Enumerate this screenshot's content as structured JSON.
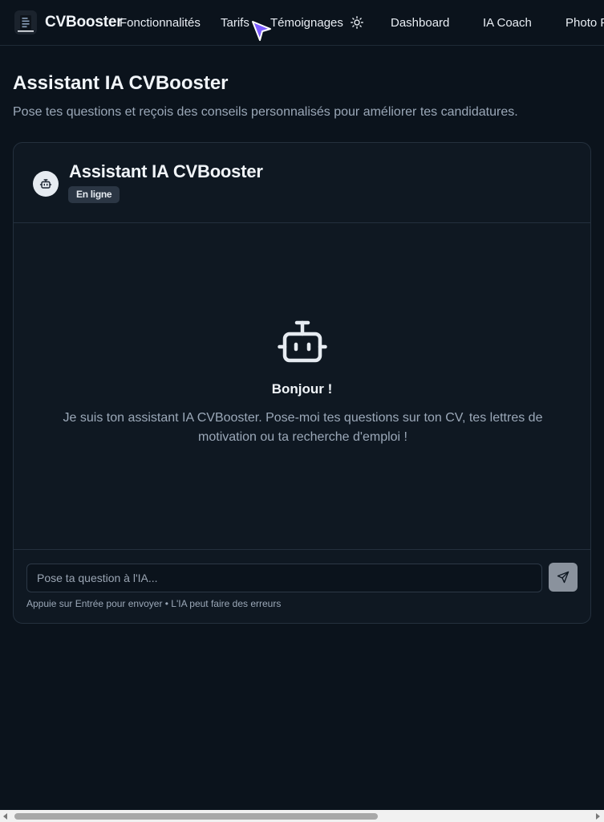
{
  "nav": {
    "brand": "CVBooster",
    "links": [
      "Fonctionnalités",
      "Tarifs",
      "Témoignages",
      "Dashboard",
      "IA Coach",
      "Photo P"
    ],
    "theme_icon": "sun-icon",
    "logo_icon": "document-icon"
  },
  "page": {
    "title": "Assistant IA CVBooster",
    "subtitle": "Pose tes questions et reçois des conseils personnalisés pour améliorer tes candidatures."
  },
  "chat": {
    "title": "Assistant IA CVBooster",
    "status": "En ligne",
    "avatar_icon": "bot-icon",
    "greeting": "Bonjour !",
    "intro": "Je suis ton assistant IA CVBooster. Pose-moi tes questions sur ton CV, tes lettres de motivation ou ta recherche d'emploi !",
    "input_placeholder": "Pose ta question à l'IA...",
    "send_icon": "send-icon",
    "hint": "Appuie sur Entrée pour envoyer • L'IA peut faire des erreurs"
  },
  "colors": {
    "background": "#0b131c",
    "card": "#0f1822",
    "border": "#24303d",
    "badge": "#2b3644",
    "send_button": "#8a929d",
    "cursor_accent": "#7c5cff"
  }
}
